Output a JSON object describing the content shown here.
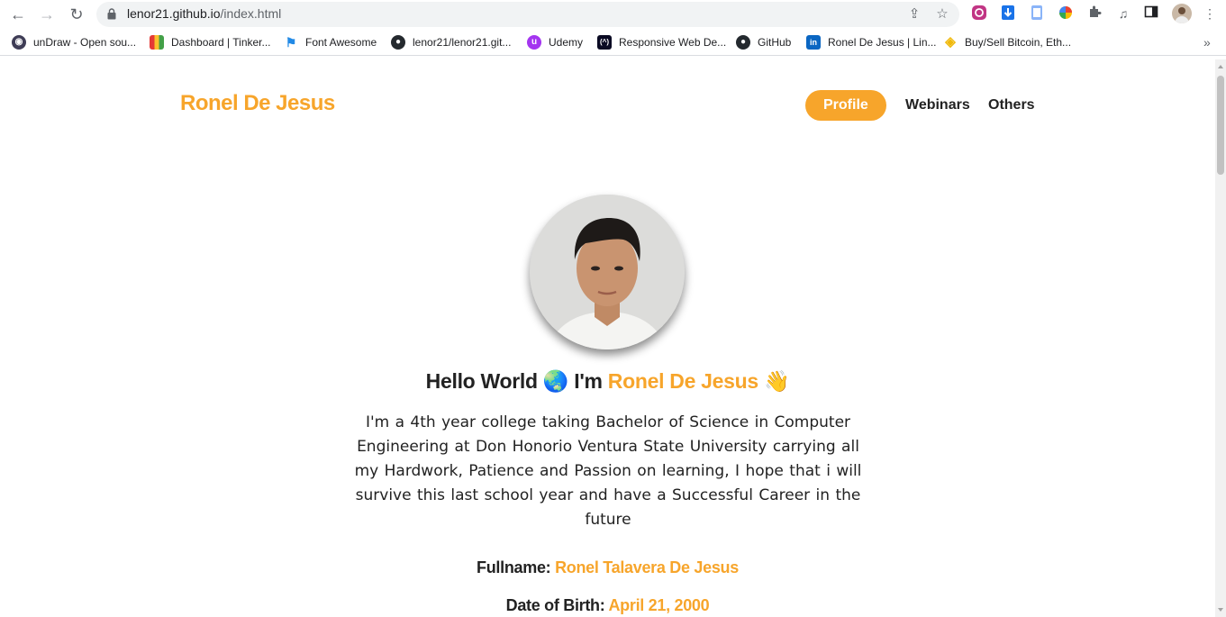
{
  "browser": {
    "url_host": "lenor21.github.io",
    "url_path": "/index.html",
    "bookmarks": [
      {
        "label": "unDraw - Open sou...",
        "icon": "undraw-icon",
        "color": "#3f3d56"
      },
      {
        "label": "Dashboard | Tinker...",
        "icon": "tinkercad-icon",
        "color": "#e53935"
      },
      {
        "label": "Font Awesome",
        "icon": "flag-icon",
        "color": "#228ae6"
      },
      {
        "label": "lenor21/lenor21.git...",
        "icon": "github-icon",
        "color": "#24292e"
      },
      {
        "label": "Udemy",
        "icon": "udemy-icon",
        "color": "#a435f0"
      },
      {
        "label": "Responsive Web De...",
        "icon": "freecodecamp-icon",
        "color": "#0a0a23"
      },
      {
        "label": "GitHub",
        "icon": "github-icon",
        "color": "#24292e"
      },
      {
        "label": "Ronel De Jesus | Lin...",
        "icon": "linkedin-icon",
        "color": "#0a66c2"
      },
      {
        "label": "Buy/Sell Bitcoin, Eth...",
        "icon": "binance-icon",
        "color": "#f0b90b"
      }
    ]
  },
  "site": {
    "brand": "Ronel De Jesus",
    "nav": [
      "Profile",
      "Webinars",
      "Others"
    ],
    "active_nav": "Profile",
    "accent_color": "#f7a52b",
    "hello_prefix": "Hello World",
    "hello_globe": "🌏",
    "hello_im": "I'm",
    "hello_name": "Ronel De Jesus",
    "hello_wave": "👋",
    "bio": "I'm a 4th year college taking Bachelor of Science in Computer Engineering at Don Honorio Ventura State University carrying all my Hardwork, Patience and Passion on learning, I hope that i will survive this last school year and have a Successful Career in the future",
    "fullname_label": "Fullname:",
    "fullname_value": "Ronel Talavera De Jesus",
    "dob_label": "Date of Birth:",
    "dob_value": "April 21, 2000"
  }
}
